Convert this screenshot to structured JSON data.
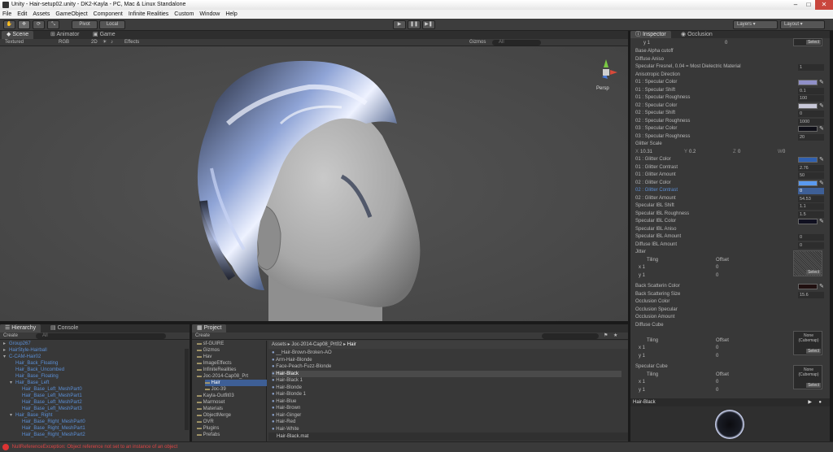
{
  "window": {
    "title": "Unity - Hair-setup02.unity - DK2-Kayla - PC, Mac & Linux Standalone"
  },
  "menu": [
    "File",
    "Edit",
    "Assets",
    "GameObject",
    "Component",
    "Infinite Realities",
    "Custom",
    "Window",
    "Help"
  ],
  "toolbar": {
    "pivot": "Pivot",
    "local": "Local",
    "layers": "Layers",
    "layout": "Layout"
  },
  "scene_tabs": [
    {
      "label": "Scene"
    },
    {
      "label": "Animator"
    },
    {
      "label": "Game"
    }
  ],
  "scene_bar": {
    "shading": "Textured",
    "rgb": "RGB",
    "mode2d": "2D",
    "effects": "Effects",
    "gizmos": "Gizmos",
    "search": "All",
    "persp": "Persp"
  },
  "hierarchy": {
    "tabs": [
      "Hierarchy",
      "Console"
    ],
    "create": "Create",
    "search": "All",
    "items": [
      {
        "label": "Group267",
        "indent": 0,
        "arrow": "▸",
        "blue": true
      },
      {
        "label": "HairStyle-Hairball",
        "indent": 0,
        "arrow": "▸",
        "blue": true
      },
      {
        "label": "C-CAM-Hair02",
        "indent": 0,
        "arrow": "▾",
        "blue": true
      },
      {
        "label": "Hair_Back_Floating",
        "indent": 1,
        "arrow": "",
        "blue": true
      },
      {
        "label": "Hair_Back_Uncombed",
        "indent": 1,
        "arrow": "",
        "blue": true
      },
      {
        "label": "Hair_Base_Floating",
        "indent": 1,
        "arrow": "",
        "blue": true
      },
      {
        "label": "Hair_Base_Left",
        "indent": 1,
        "arrow": "▾",
        "blue": true
      },
      {
        "label": "Hair_Base_Left_MeshPart0",
        "indent": 2,
        "arrow": "",
        "blue": true
      },
      {
        "label": "Hair_Base_Left_MeshPart1",
        "indent": 2,
        "arrow": "",
        "blue": true
      },
      {
        "label": "Hair_Base_Left_MeshPart2",
        "indent": 2,
        "arrow": "",
        "blue": true
      },
      {
        "label": "Hair_Base_Left_MeshPart3",
        "indent": 2,
        "arrow": "",
        "blue": true
      },
      {
        "label": "Hair_Base_Right",
        "indent": 1,
        "arrow": "▾",
        "blue": true
      },
      {
        "label": "Hair_Base_Right_MeshPart0",
        "indent": 2,
        "arrow": "",
        "blue": true
      },
      {
        "label": "Hair_Base_Right_MeshPart1",
        "indent": 2,
        "arrow": "",
        "blue": true
      },
      {
        "label": "Hair_Base_Right_MeshPart2",
        "indent": 2,
        "arrow": "",
        "blue": true
      }
    ]
  },
  "project": {
    "tab": "Project",
    "create": "Create",
    "folders": [
      {
        "label": "sf-GUIRE",
        "indent": 0
      },
      {
        "label": "Gizmos",
        "indent": 0
      },
      {
        "label": "Hav",
        "indent": 0
      },
      {
        "label": "ImageEffects",
        "indent": 0
      },
      {
        "label": "InfiniteRealities",
        "indent": 0
      },
      {
        "label": "Joc-2014-Cap08_Prt",
        "indent": 0
      },
      {
        "label": "Hair",
        "indent": 1,
        "selected": true
      },
      {
        "label": "Joc-39",
        "indent": 1
      },
      {
        "label": "Kayla-Outfit03",
        "indent": 0
      },
      {
        "label": "Marmoset",
        "indent": 0
      },
      {
        "label": "Materials",
        "indent": 0
      },
      {
        "label": "ObjectMerge",
        "indent": 0
      },
      {
        "label": "OVR",
        "indent": 0
      },
      {
        "label": "Plugins",
        "indent": 0
      },
      {
        "label": "Prefabs",
        "indent": 0
      }
    ],
    "breadcrumb": [
      "Assets",
      "Joc-2014-Cap08_Prt02",
      "Hair"
    ],
    "assets": [
      "__Hair-Brown-Broken-AO",
      "Arm-Hair-Blonde",
      "Face-Peach-Fuzz-Blonde",
      "Hair-Black",
      "Hair-Black 1",
      "Hair-Blonde",
      "Hair-Blonde 1",
      "Hair-Blue",
      "Hair-Brown",
      "Hair-Ginger",
      "Hair-Red",
      "Hair-White"
    ],
    "selected_asset": "Hair-Black",
    "footer": "Hair-Black.mat"
  },
  "inspector": {
    "tabs": [
      "Inspector",
      "Occlusion"
    ],
    "top_y": "y  1",
    "top_val": "0",
    "rows": [
      {
        "label": "Base Alpha cutoff",
        "kind": "none"
      },
      {
        "label": "Diffuse Aniso",
        "kind": "none"
      },
      {
        "label": "Specular Fresnel, 0.04 = Most Dielectric Material",
        "kind": "val",
        "value": "1"
      },
      {
        "label": "Anisotropic Direction",
        "kind": "none"
      },
      {
        "label": "01 : Specular Color",
        "kind": "color",
        "color": "#9090c8"
      },
      {
        "label": "01 : Specular Shift",
        "kind": "val",
        "value": "0.1"
      },
      {
        "label": "01 : Specular Roughness",
        "kind": "val",
        "value": "100"
      },
      {
        "label": "02 : Specular Color",
        "kind": "color",
        "color": "#c8c8d8"
      },
      {
        "label": "02 : Specular Shift",
        "kind": "val",
        "value": "0"
      },
      {
        "label": "02 : Specular Roughness",
        "kind": "val",
        "value": "1000"
      },
      {
        "label": "03 : Specular Color",
        "kind": "color",
        "color": "#101018"
      },
      {
        "label": "03 : Specular Roughness",
        "kind": "val",
        "value": "20"
      },
      {
        "label": "Glitter Scale",
        "kind": "none"
      }
    ],
    "glitter_scale": {
      "x": "10.31",
      "y": "0.2",
      "z": "0",
      "w": "0"
    },
    "rows2": [
      {
        "label": "01 : Glitter Color",
        "kind": "color",
        "color": "#3060b0"
      },
      {
        "label": "01 : Glitter Contrast",
        "kind": "val",
        "value": "2.76"
      },
      {
        "label": "01 : Glitter Amount",
        "kind": "val",
        "value": "50"
      },
      {
        "label": "02 : Glitter Color",
        "kind": "color",
        "color": "#5a9af0"
      },
      {
        "label": "02 : Glitter Contrast",
        "kind": "val",
        "value": "0",
        "highlight": true
      },
      {
        "label": "02 : Glitter Amount",
        "kind": "val",
        "value": "54.53"
      },
      {
        "label": "Specular IBL Shift",
        "kind": "val",
        "value": "1.1"
      },
      {
        "label": "Specular IBL Roughness",
        "kind": "val",
        "value": "1.5"
      },
      {
        "label": "Specular IBL Color",
        "kind": "color",
        "color": "#101020"
      },
      {
        "label": "Specular IBL Aniso",
        "kind": "none"
      },
      {
        "label": "Specular IBL Amount",
        "kind": "val",
        "value": "0"
      },
      {
        "label": "Diffuse IBL Amount",
        "kind": "val",
        "value": "0"
      },
      {
        "label": "Jitter",
        "kind": "none"
      }
    ],
    "tiling_label": "Tiling",
    "offset_label": "Offset",
    "jitter": {
      "x": "x  1",
      "y": "y  1",
      "ox": "0",
      "oy": "0"
    },
    "rows3": [
      {
        "label": "Back Scatterin Color",
        "kind": "color",
        "color": "#201010"
      },
      {
        "label": "Back Scattering Size",
        "kind": "val",
        "value": "15.6"
      },
      {
        "label": "Occlusion Color",
        "kind": "none"
      },
      {
        "label": "Occlusion Specular",
        "kind": "none"
      },
      {
        "label": "Occlusion Amount",
        "kind": "none"
      },
      {
        "label": "Diffuse Cube",
        "kind": "none"
      }
    ],
    "diffuse_cube": {
      "x": "x  1",
      "y": "y  1",
      "ox": "0",
      "oy": "0",
      "slot": "None (Cubemap)"
    },
    "specular_cube_label": "Specular Cube",
    "specular_cube": {
      "x": "x  1",
      "y": "y  1",
      "ox": "0",
      "oy": "0",
      "slot": "None (Cubemap)"
    },
    "select": "Select"
  },
  "preview": {
    "title": "Hair-Black"
  },
  "status": {
    "message": "NullReferenceException: Object reference not set to an instance of an object"
  }
}
